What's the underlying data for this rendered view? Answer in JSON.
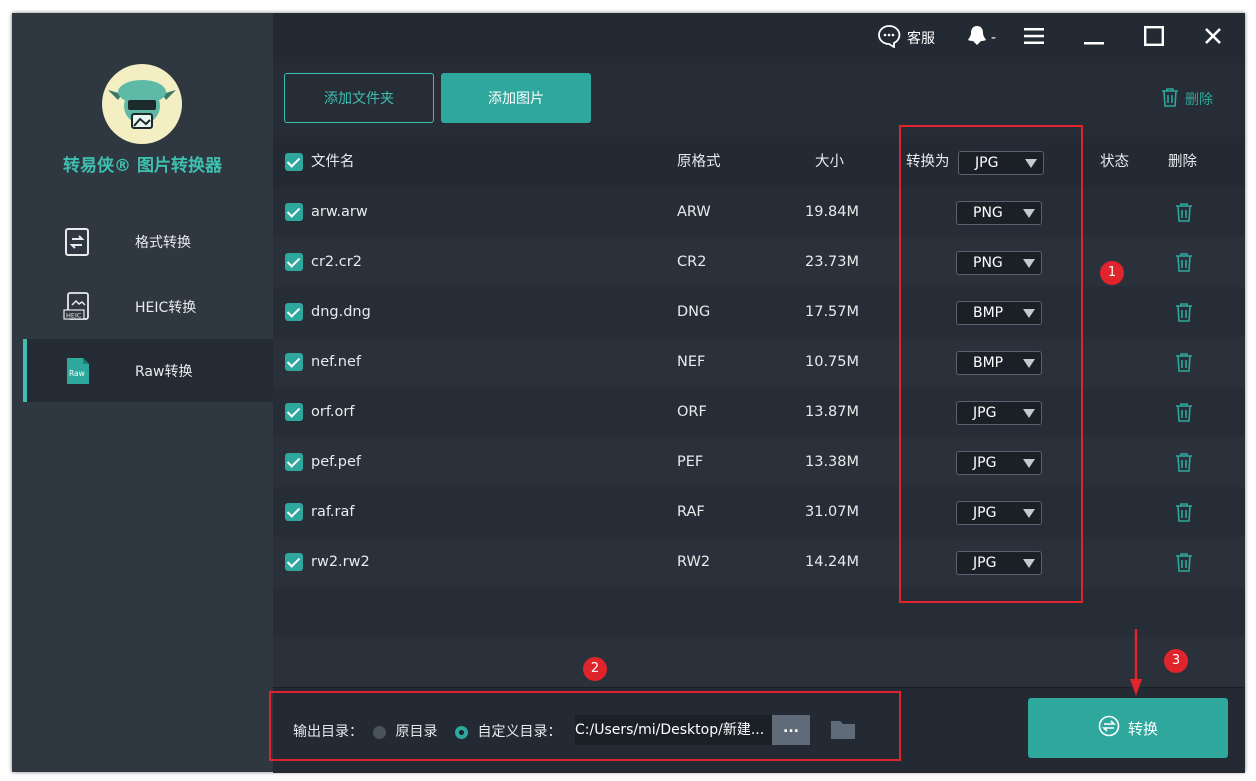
{
  "app": {
    "brand": "转易侠® 图片转换器"
  },
  "topbar": {
    "support_label": "客服",
    "user_label": "-"
  },
  "sidebar": {
    "items": [
      {
        "label": "格式转换",
        "icon": "convert-icon"
      },
      {
        "label": "HEIC转换",
        "icon": "heic-icon"
      },
      {
        "label": "Raw转换",
        "icon": "raw-icon",
        "icon_text": "Raw"
      }
    ]
  },
  "toolbar": {
    "add_folder": "添加文件夹",
    "add_images": "添加图片",
    "delete": "删除"
  },
  "table": {
    "headers": {
      "name": "文件名",
      "orig_format": "原格式",
      "size": "大小",
      "convert_to": "转换为",
      "status": "状态",
      "delete": "删除"
    },
    "global_target": "JPG",
    "rows": [
      {
        "name": "arw.arw",
        "format": "ARW",
        "size": "19.84M",
        "target": "PNG"
      },
      {
        "name": "cr2.cr2",
        "format": "CR2",
        "size": "23.73M",
        "target": "PNG"
      },
      {
        "name": "dng.dng",
        "format": "DNG",
        "size": "17.57M",
        "target": "BMP"
      },
      {
        "name": "nef.nef",
        "format": "NEF",
        "size": "10.75M",
        "target": "BMP"
      },
      {
        "name": "orf.orf",
        "format": "ORF",
        "size": "13.87M",
        "target": "JPG"
      },
      {
        "name": "pef.pef",
        "format": "PEF",
        "size": "13.38M",
        "target": "JPG"
      },
      {
        "name": "raf.raf",
        "format": "RAF",
        "size": "31.07M",
        "target": "JPG"
      },
      {
        "name": "rw2.rw2",
        "format": "RW2",
        "size": "14.24M",
        "target": "JPG"
      }
    ]
  },
  "output": {
    "label": "输出目录：",
    "option_original": "原目录",
    "option_custom": "自定义目录：",
    "path": "C:/Users/mi/Desktop/新建...",
    "browse": "..."
  },
  "convert_button": "转换",
  "annotations": [
    "1",
    "2",
    "3"
  ],
  "colors": {
    "accent": "#2ea79c",
    "sidebar": "#2f3740",
    "content": "#232a33",
    "highlight": "#e0242b"
  }
}
